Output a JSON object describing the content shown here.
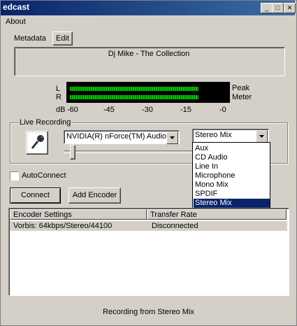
{
  "window": {
    "title": "edcast",
    "minimize": "_",
    "maximize": "□",
    "close": "✕"
  },
  "menu": {
    "about": "About"
  },
  "metadata": {
    "label": "Metadata",
    "edit_button": "Edit",
    "display_text": "Dj Mike - The Collection"
  },
  "meter": {
    "left_label": "L",
    "right_label": "R",
    "peak_label": "Peak",
    "meter_label": "Meter",
    "db_label": "dB",
    "scale": [
      "-60",
      "-45",
      "-30",
      "-15",
      "-0"
    ],
    "left_level": 0.9,
    "right_level": 0.9
  },
  "live_recording": {
    "group_label": "Live Recording",
    "device_value": "NVIDIA(R) nForce(TM) Audio",
    "source_value": "Stereo Mix",
    "source_options": [
      "Aux",
      "CD Audio",
      "Line In",
      "Microphone",
      "Mono Mix",
      "SPDIF",
      "Stereo Mix"
    ],
    "selected_option": "Stereo Mix",
    "volume_level": 0.05
  },
  "autoconnect": {
    "label": "AutoConnect",
    "checked": false
  },
  "buttons": {
    "connect": "Connect",
    "add_encoder": "Add Encoder"
  },
  "encoders": {
    "headers": [
      "Encoder Settings",
      "Transfer Rate"
    ],
    "rows": [
      {
        "settings": "Vorbis: 64kbps/Stereo/44100",
        "rate": "Disconnected"
      }
    ]
  },
  "status": {
    "text": "Recording from Stereo Mix"
  },
  "icons": {
    "microphone": "microphone-icon",
    "dropdown": "chevron-down-icon"
  }
}
